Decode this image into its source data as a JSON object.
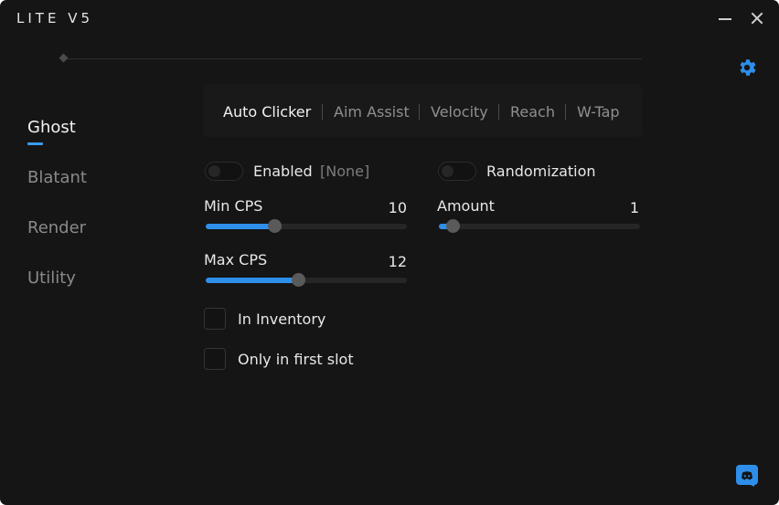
{
  "app": {
    "title": "LITE V5"
  },
  "sidebar": {
    "items": [
      {
        "label": "Ghost",
        "active": true
      },
      {
        "label": "Blatant"
      },
      {
        "label": "Render"
      },
      {
        "label": "Utility"
      }
    ]
  },
  "tabs": [
    {
      "label": "Auto Clicker",
      "active": true
    },
    {
      "label": "Aim Assist"
    },
    {
      "label": "Velocity"
    },
    {
      "label": "Reach"
    },
    {
      "label": "W-Tap"
    }
  ],
  "settings": {
    "enabled": {
      "label": "Enabled",
      "keybind": "[None]",
      "on": false
    },
    "randomization": {
      "label": "Randomization",
      "on": false
    },
    "min_cps": {
      "label": "Min CPS",
      "value": "10",
      "fill_fraction": 0.34
    },
    "max_cps": {
      "label": "Max CPS",
      "value": "12",
      "fill_fraction": 0.46
    },
    "amount": {
      "label": "Amount",
      "value": "1",
      "fill_fraction": 0.07
    },
    "in_inventory": {
      "label": "In Inventory",
      "checked": false
    },
    "only_first_slot": {
      "label": "Only in first slot",
      "checked": false
    }
  },
  "icons": {
    "settings": "gear-icon",
    "discord": "discord-icon"
  },
  "colors": {
    "accent": "#2e8fea",
    "background": "#151515"
  }
}
